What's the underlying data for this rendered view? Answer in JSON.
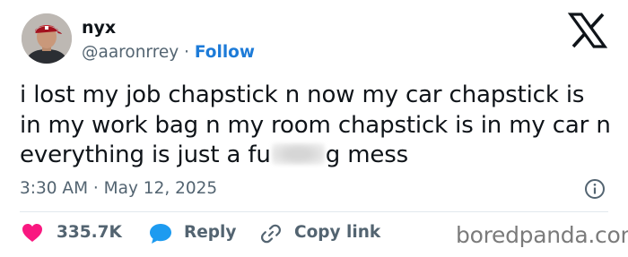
{
  "author": {
    "name": "nyx",
    "handle": "@aaronrrey",
    "separator": "·",
    "follow_label": "Follow"
  },
  "tweet": {
    "text_line1": "i lost my job chapstick n now my car chapstick is",
    "text_line2": "in my work bag n my room chapstick is in my car n",
    "text_line3_before": "everything is just a fu",
    "text_line3_after": "g mess"
  },
  "timestamp": "3:30 AM · May 12, 2025",
  "actions": {
    "likes": "335.7K",
    "reply_label": "Reply",
    "copy_link_label": "Copy link"
  },
  "watermark": "boredpanda.com",
  "icons": {
    "logo": "x-logo-icon",
    "like": "heart-icon",
    "reply": "speech-bubble-icon",
    "copy": "link-icon",
    "info": "info-icon"
  },
  "colors": {
    "like": "#f91880",
    "reply": "#1d9bf0",
    "follow": "#1d7bd8",
    "secondary_text": "#536471"
  }
}
